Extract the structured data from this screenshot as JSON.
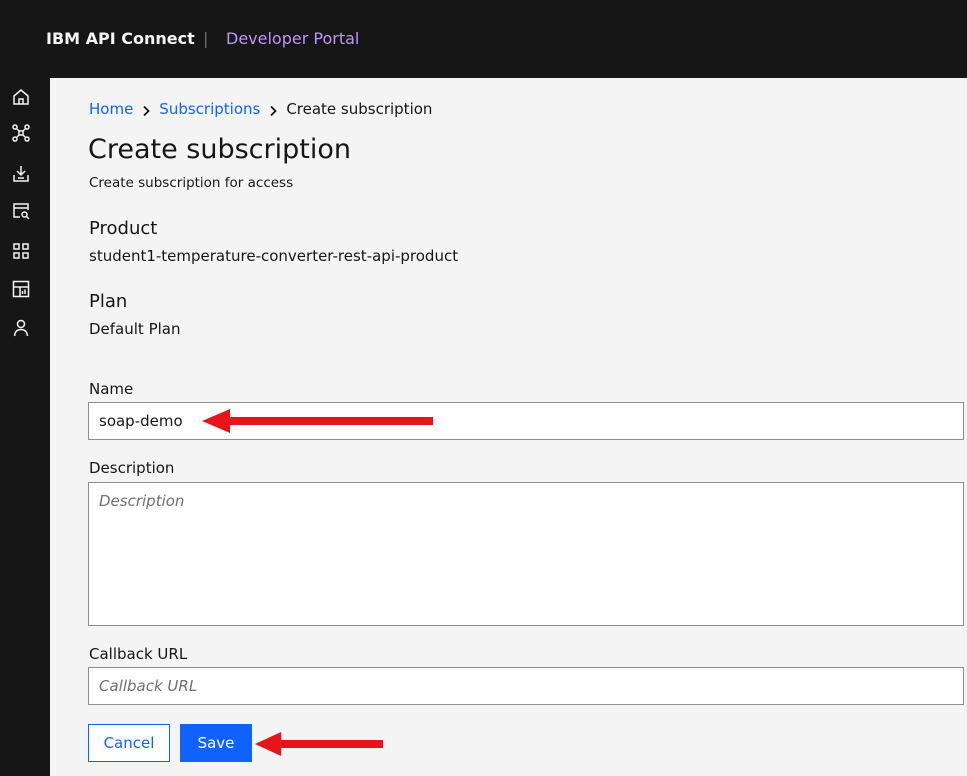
{
  "header": {
    "brand": "IBM API Connect",
    "divider": "|",
    "portal": "Developer Portal"
  },
  "sidenav": {
    "icons": [
      "home-icon",
      "api-network-icon",
      "download-icon",
      "browser-search-icon",
      "apps-grid-icon",
      "dashboard-icon",
      "user-icon"
    ]
  },
  "breadcrumb": {
    "home": "Home",
    "subscriptions": "Subscriptions",
    "current": "Create subscription"
  },
  "page": {
    "title": "Create subscription",
    "subtitle": "Create subscription for access"
  },
  "product": {
    "label": "Product",
    "value": "student1-temperature-converter-rest-api-product"
  },
  "plan": {
    "label": "Plan",
    "value": "Default Plan"
  },
  "form": {
    "name": {
      "label": "Name",
      "value": "soap-demo"
    },
    "description": {
      "label": "Description",
      "placeholder": "Description"
    },
    "callback": {
      "label": "Callback URL",
      "placeholder": "Callback URL"
    },
    "cancel_label": "Cancel",
    "save_label": "Save"
  },
  "colors": {
    "header_bg": "#161616",
    "content_bg": "#f4f4f4",
    "primary": "#0f62fe",
    "portal_text": "#be95ff",
    "annotation_arrow": "#e8141b"
  }
}
